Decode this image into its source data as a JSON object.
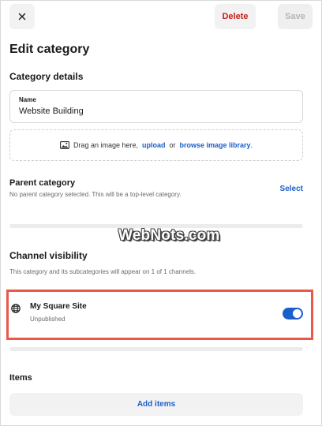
{
  "topbar": {
    "close_icon": "close-icon",
    "delete_label": "Delete",
    "save_label": "Save"
  },
  "page_title": "Edit category",
  "details": {
    "section_title": "Category details",
    "name_label": "Name",
    "name_value": "Website Building",
    "dropzone": {
      "icon": "image-icon",
      "prefix": "Drag an image here,",
      "upload_link": "upload",
      "or_text": "or",
      "library_link": "browse image library",
      "suffix": "."
    }
  },
  "parent": {
    "title": "Parent category",
    "description": "No parent category selected. This will be a top-level category.",
    "select_label": "Select"
  },
  "watermark": "WebNots.com",
  "channel": {
    "section_title": "Channel visibility",
    "description": "This category and its subcategories will appear on 1 of 1 channels.",
    "site_icon": "globe-icon",
    "site_name": "My Square Site",
    "site_status": "Unpublished",
    "toggle_on": true
  },
  "items": {
    "section_title": "Items",
    "add_label": "Add items"
  },
  "colors": {
    "accent": "#1a5fcc",
    "danger": "#c0211a",
    "highlight_border": "#e8594a"
  }
}
